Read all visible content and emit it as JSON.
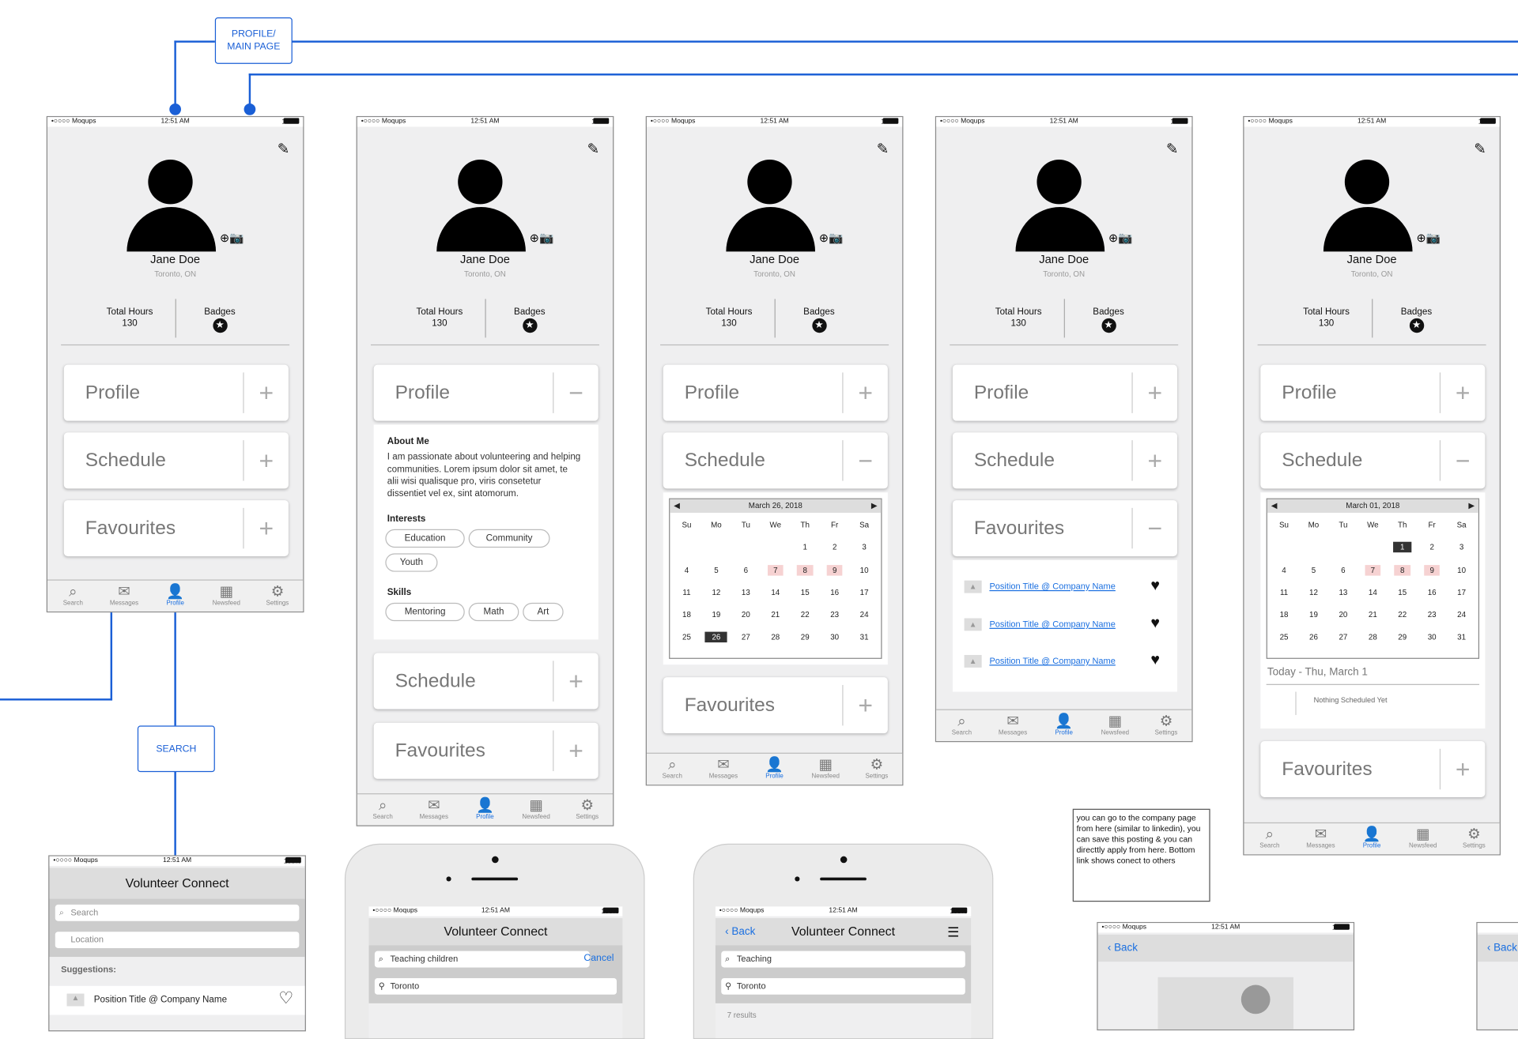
{
  "flow": {
    "profile_main_label": "PROFILE/\nMAIN PAGE",
    "search_label": "SEARCH"
  },
  "status": {
    "carrier": "•○○○○ Moqups",
    "time": "12:51 AM",
    "battery": "100%"
  },
  "profile": {
    "name": "Jane Doe",
    "location": "Toronto, ON",
    "hours_label": "Total Hours",
    "hours": "130",
    "badges_label": "Badges"
  },
  "sections": {
    "profile": "Profile",
    "schedule": "Schedule",
    "favourites": "Favourites"
  },
  "tabs": {
    "search": "Search",
    "messages": "Messages",
    "profile": "Profile",
    "newsfeed": "Newsfeed",
    "settings": "Settings"
  },
  "about": {
    "title": "About Me",
    "text": "I am passionate about volunteering and helping communities. Lorem ipsum dolor sit amet, te alii wisi qualisque pro, viris consetetur dissentiet vel ex, sint atomorum.",
    "interests_title": "Interests",
    "interests": [
      "Education",
      "Community",
      "Youth"
    ],
    "skills_title": "Skills",
    "skills": [
      "Mentoring",
      "Math",
      "Art"
    ]
  },
  "calendar1": {
    "title": "March 26, 2018",
    "days": [
      "Su",
      "Mo",
      "Tu",
      "We",
      "Th",
      "Fr",
      "Sa"
    ],
    "cells": [
      "",
      "",
      "",
      "",
      "1",
      "2",
      "3",
      "4",
      "5",
      "6",
      "7",
      "8",
      "9",
      "10",
      "11",
      "12",
      "13",
      "14",
      "15",
      "16",
      "17",
      "18",
      "19",
      "20",
      "21",
      "22",
      "23",
      "24",
      "25",
      "26",
      "27",
      "28",
      "29",
      "30",
      "31"
    ]
  },
  "calendar2": {
    "title": "March 01, 2018",
    "today": "Today - Thu, March 1",
    "nothing": "Nothing Scheduled Yet"
  },
  "favourites": {
    "item": "Position Title @ Company Name"
  },
  "note": "you can go to the company page from here (similar to linkedin), you can save this posting & you can directtly apply from here. Bottom link shows conect to others",
  "search": {
    "app_title": "Volunteer Connect",
    "search_ph": "Search",
    "location_ph": "Location",
    "suggestions": "Suggestions:",
    "suggestion_item": "Position Title @ Company Name",
    "query1": "Teaching children",
    "cancel": "Cancel",
    "loc": "Toronto",
    "query2": "Teaching",
    "back": "Back",
    "results": "7 results"
  }
}
